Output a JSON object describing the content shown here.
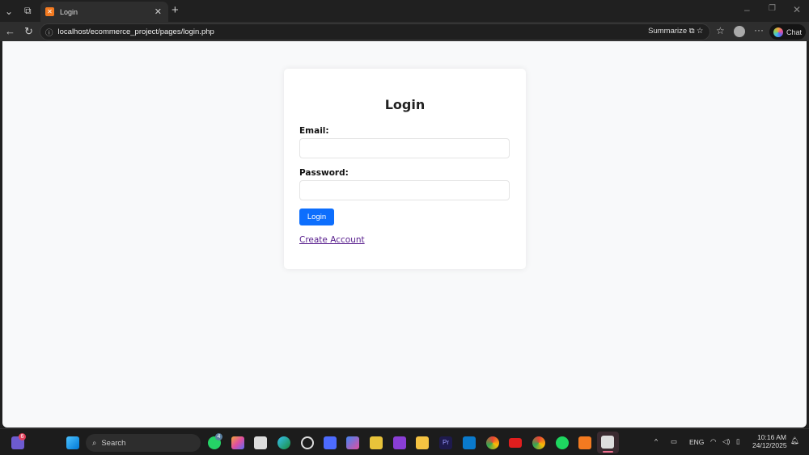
{
  "browser": {
    "tab_title": "Login",
    "url": "localhost/ecommerce_project/pages/login.php",
    "summarize_label": "Summarize",
    "chat_label": "Chat"
  },
  "form": {
    "title": "Login",
    "email_label": "Email:",
    "email_value": "",
    "password_label": "Password:",
    "password_value": "",
    "submit_label": "Login",
    "create_account_link": "Create Account"
  },
  "taskbar": {
    "search_label": "Search",
    "widgets_badge": "6",
    "whatsapp_badge": "4",
    "language": "ENG",
    "time": "10:16 AM",
    "date": "24/12/2025",
    "accent": "#0d6efd"
  }
}
